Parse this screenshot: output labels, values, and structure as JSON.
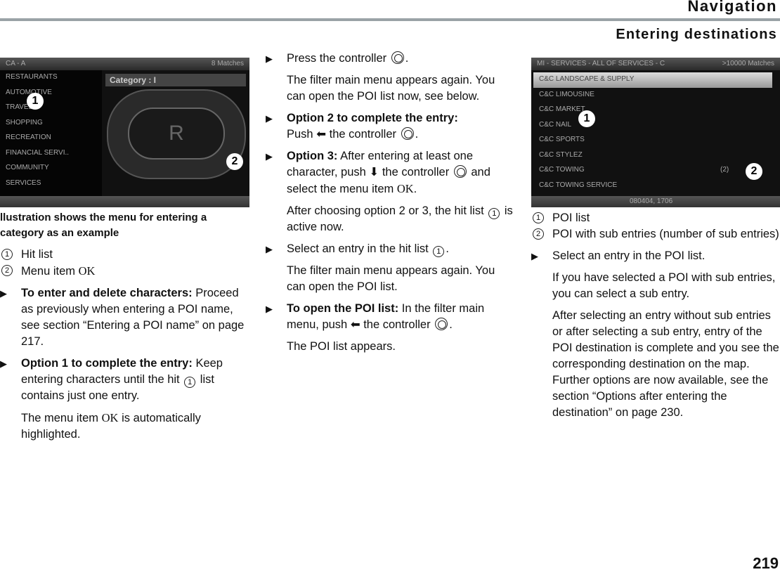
{
  "header": {
    "chapter": "Navigation",
    "section": "Entering destinations",
    "page_number": "219"
  },
  "figure1": {
    "title": "CA - A",
    "matches": "8 Matches",
    "categories": [
      "RESTAURANTS",
      "AUTOMOTIVE",
      "TRAVEL",
      "SHOPPING",
      "RECREATION",
      "FINANCIAL SERVI..",
      "COMMUNITY",
      "SERVICES"
    ],
    "input_label": "Category : I",
    "key_letter": "R",
    "marker1": "1",
    "marker2": "2",
    "caption": "llustration shows the menu for entering a category as an example",
    "legend": [
      {
        "num": "1",
        "text": "Hit list"
      },
      {
        "num": "2",
        "text": "Menu item ",
        "ok": "OK"
      }
    ]
  },
  "left": {
    "b1_bold": "To enter and delete characters:",
    "b1_text": " Proceed as previously when entering a POI name, see section “Entering a POI name” on page 217.",
    "b2_bold": "Option 1 to complete the entry:",
    "b2_text1": " Keep entering characters until the hit ",
    "b2_num": "1",
    "b2_text2": " list contains just one entry.",
    "p1_a": "The menu item ",
    "p1_ok": "OK",
    "p1_b": " is automatically highlighted."
  },
  "middle": {
    "b1": "Press the controller ",
    "b1_end": ".",
    "p1": "The filter main menu appears again. You can open the POI list now, see below.",
    "b2_bold": "Option 2 to complete the entry:",
    "b2_a": " Push ",
    "b2_b": " the controller ",
    "b2_end": ".",
    "b3_bold": "Option 3:",
    "b3_a": " After entering at least one character, push ",
    "b3_b": " the controller ",
    "b3_c": " and select the menu item ",
    "b3_ok": "OK",
    "b3_end": ".",
    "p2_a": "After choosing option 2 or 3, the hit list ",
    "p2_num": "1",
    "p2_b": " is active now.",
    "b4_a": "Select an entry in the hit list ",
    "b4_num": "1",
    "b4_end": ".",
    "p3": "The filter main menu appears again. You can open the POI list.",
    "b5_bold": "To open the POI list:",
    "b5_a": " In the filter main menu, push ",
    "b5_b": " the controller ",
    "b5_end": ".",
    "p4": "The POI list appears."
  },
  "figure2": {
    "title": "MI - SERVICES - ALL OF SERVICES - C",
    "matches": ">10000 Matches",
    "entries": [
      "C&C LANDSCAPE & SUPPLY",
      "C&C LIMOUSINE",
      "C&C MARKET",
      "C&C NAIL",
      "C&C SPORTS",
      "C&C STYLEZ",
      "C&C TOWING",
      "C&C TOWING SERVICE"
    ],
    "sub_count": "(2)",
    "status": "080404, 1706",
    "marker1": "1",
    "marker2": "2",
    "legend": [
      {
        "num": "1",
        "text": "POI list"
      },
      {
        "num": "2",
        "text": "POI with sub entries (number of sub entries)"
      }
    ]
  },
  "right": {
    "b1": "Select an entry in the POI list.",
    "p1": "If you have selected a POI with sub entries, you can select a sub entry.",
    "p2": "After selecting an entry without sub entries or after selecting a sub entry, entry of the POI destination is complete and you see the corresponding destination on the map. Further options are now available, see the section “Options after entering the destination” on page 230."
  }
}
